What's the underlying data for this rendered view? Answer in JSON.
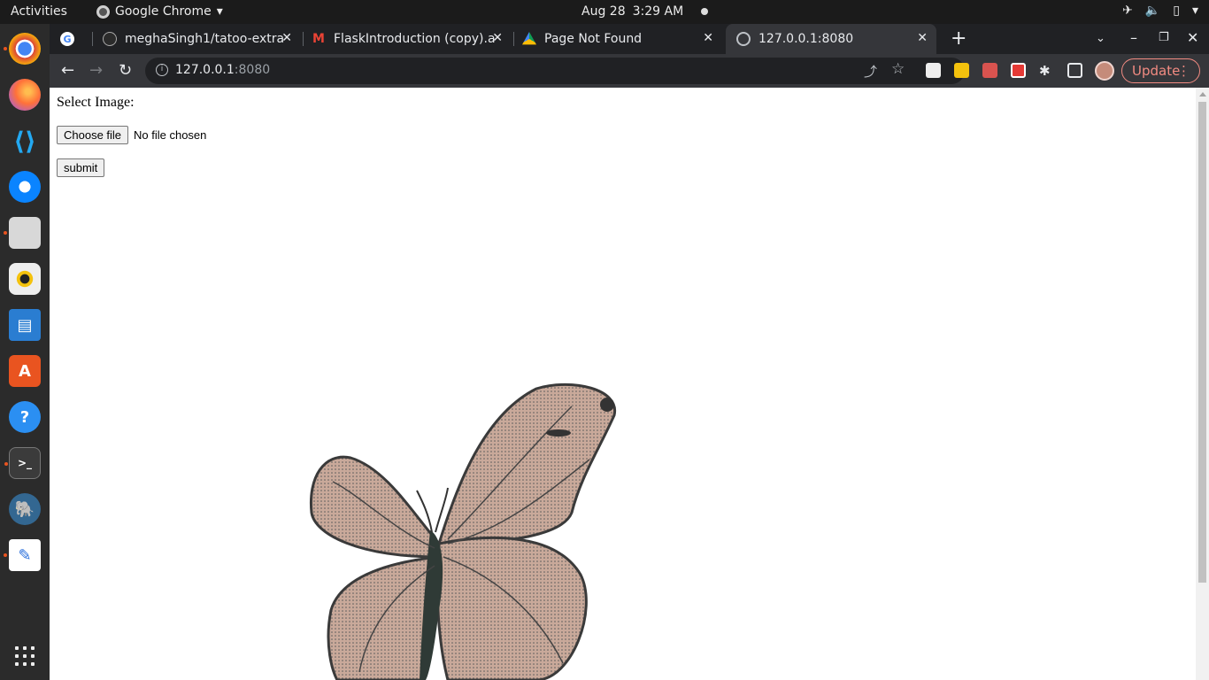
{
  "system": {
    "activities": "Activities",
    "app_name": "Google Chrome",
    "date": "Aug 28",
    "time": "3:29 AM"
  },
  "browser": {
    "tabs": [
      {
        "title": "",
        "icon": "google-icon"
      },
      {
        "title": "meghaSingh1/tatoo-extra",
        "icon": "github-icon"
      },
      {
        "title": "FlaskIntroduction (copy).a",
        "icon": "gmail-icon"
      },
      {
        "title": "Page Not Found",
        "icon": "google-drive-icon"
      },
      {
        "title": "127.0.0.1:8080",
        "icon": "globe-icon",
        "active": true
      }
    ],
    "url_host": "127.0.0.1",
    "url_port": ":8080",
    "update_label": "Update"
  },
  "page": {
    "select_label": "Select Image:",
    "choose_file_label": "Choose file",
    "file_status": "No file chosen",
    "submit_label": "submit"
  },
  "colors": {
    "accent": "#e95420",
    "update": "#f28b82",
    "chrome_dark": "#202124",
    "chrome_toolbar": "#35363a"
  }
}
